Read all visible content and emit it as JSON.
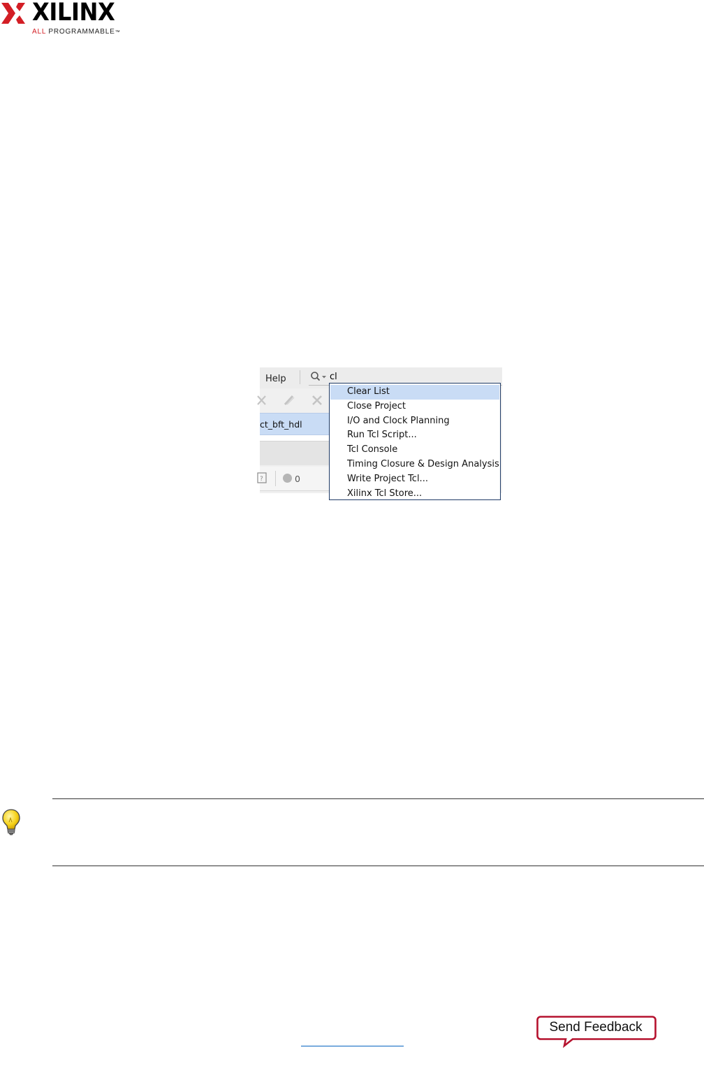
{
  "logo": {
    "wordmark": "XILINX",
    "tagline_red": "ALL",
    "tagline_black": " PROGRAMMABLE",
    "tagline_mark": "™",
    "brand_red": "#d31e25"
  },
  "figure": {
    "menu": {
      "help_label": "Help"
    },
    "search": {
      "value": "cl",
      "icon": "search-icon"
    },
    "project_row": {
      "name": "ct_bft_hdl"
    },
    "status": {
      "count": "0"
    },
    "dropdown": {
      "selected_index": 0,
      "items": [
        {
          "label": "Clear List"
        },
        {
          "label": "Close Project"
        },
        {
          "label": "I/O and Clock Planning"
        },
        {
          "label": "Run Tcl Script..."
        },
        {
          "label": "Tcl Console"
        },
        {
          "label": "Timing Closure & Design Analysis"
        },
        {
          "label": "Write Project Tcl..."
        },
        {
          "label": "Xilinx Tcl Store..."
        }
      ]
    }
  },
  "feedback": {
    "label": "Send Feedback"
  }
}
